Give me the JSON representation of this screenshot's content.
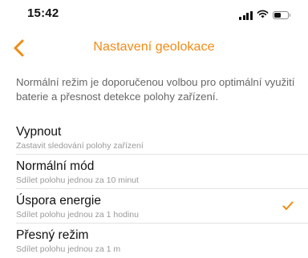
{
  "status_bar": {
    "time": "15:42",
    "icons": [
      "signal-icon",
      "wifi-icon",
      "battery-icon"
    ],
    "battery_level": 0.55
  },
  "nav": {
    "back_icon": "chevron-left-icon",
    "title": "Nastavení geolokace"
  },
  "description": "Normální režim je doporučenou volbou pro optimální využití baterie a přesnost detekce polohy zařízení.",
  "options": [
    {
      "title": "Vypnout",
      "subtitle": "Zastavit sledování polohy zařízení",
      "selected": false
    },
    {
      "title": "Normální mód",
      "subtitle": "Sdílet polohu jednou za 10 minut",
      "selected": false
    },
    {
      "title": "Úspora energie",
      "subtitle": "Sdílet polohu jednou za 1 hodinu",
      "selected": true
    },
    {
      "title": "Přesný režim",
      "subtitle": "Sdílet polohu jednou za 1 m",
      "selected": false
    }
  ],
  "colors": {
    "accent": "#f28a14",
    "text_primary": "#111111",
    "text_secondary": "#666666",
    "text_muted": "#9a9a9a",
    "divider": "#e3e3e3",
    "background": "#ffffff"
  }
}
